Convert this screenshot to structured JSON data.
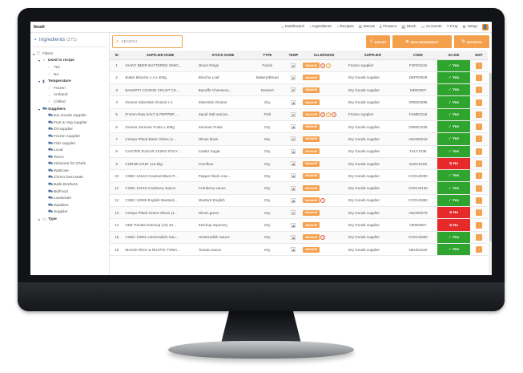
{
  "app": {
    "logo": "Itoodi"
  },
  "nav": [
    {
      "icon": "⌂",
      "label": "Dashboard"
    },
    {
      "icon": "◔",
      "label": "Ingredients"
    },
    {
      "icon": "◔",
      "label": "Recipes"
    },
    {
      "icon": "☰",
      "label": "Menus"
    },
    {
      "icon": "£",
      "label": "Finance"
    },
    {
      "icon": "▤",
      "label": "Stock"
    },
    {
      "icon": "▭",
      "label": "Accounts"
    },
    {
      "icon": "?",
      "label": "FAQ"
    },
    {
      "icon": "⚙",
      "label": "Setup"
    }
  ],
  "sidebar": {
    "title": "Ingredients",
    "count": "(271)",
    "filters_label": "Filters",
    "tree": [
      {
        "level": 0,
        "arrow": "▾",
        "icon": "▽",
        "label": "Filters",
        "bold": false
      },
      {
        "level": 1,
        "arrow": "▾",
        "icon": "◔",
        "label": "Used in recipe",
        "bold": true
      },
      {
        "level": 2,
        "arrow": "",
        "icon": "◌",
        "label": "Yes",
        "bold": false
      },
      {
        "level": 2,
        "arrow": "",
        "icon": "◌",
        "label": "No",
        "bold": false
      },
      {
        "level": 1,
        "arrow": "▾",
        "icon": "▮",
        "label": "Temperature",
        "bold": true
      },
      {
        "level": 2,
        "arrow": "",
        "icon": "◌",
        "label": "Frozen",
        "bold": false
      },
      {
        "level": 2,
        "arrow": "",
        "icon": "◌",
        "label": "Ambient",
        "bold": false
      },
      {
        "level": 2,
        "arrow": "",
        "icon": "◌",
        "label": "Chilled",
        "bold": false
      },
      {
        "level": 1,
        "arrow": "▾",
        "icon": "⛟",
        "label": "Suppliers",
        "bold": true
      },
      {
        "level": 2,
        "arrow": "",
        "icon": "⛟",
        "label": "Dry Goods supplier",
        "bold": false
      },
      {
        "level": 2,
        "arrow": "",
        "icon": "⛟",
        "label": "Fruit & Veg supplier",
        "bold": false
      },
      {
        "level": 2,
        "arrow": "",
        "icon": "⛟",
        "label": "Oil supplier",
        "bold": false
      },
      {
        "level": 2,
        "arrow": "",
        "icon": "⛟",
        "label": "Frozen supplier",
        "bold": false
      },
      {
        "level": 2,
        "arrow": "",
        "icon": "⛟",
        "label": "Fish supplier",
        "bold": false
      },
      {
        "level": 2,
        "arrow": "",
        "icon": "⛟",
        "label": "Local",
        "bold": false
      },
      {
        "level": 2,
        "arrow": "",
        "icon": "⛟",
        "label": "Tesco",
        "bold": false
      },
      {
        "level": 2,
        "arrow": "",
        "icon": "⛟",
        "label": "Infusions for Chefs",
        "bold": false
      },
      {
        "level": 2,
        "arrow": "",
        "icon": "⛟",
        "label": "Waitrose",
        "bold": false
      },
      {
        "level": 2,
        "arrow": "",
        "icon": "⛟",
        "label": "Chris's best Mate",
        "bold": false
      },
      {
        "level": 2,
        "arrow": "",
        "icon": "⛟",
        "label": "Balls Brothers",
        "bold": false
      },
      {
        "level": 2,
        "arrow": "",
        "icon": "⛟",
        "label": "BidFood",
        "bold": false
      },
      {
        "level": 2,
        "arrow": "",
        "icon": "⛟",
        "label": "Lowlander",
        "bold": false
      },
      {
        "level": 2,
        "arrow": "",
        "icon": "⛟",
        "label": "Waddies",
        "bold": false
      },
      {
        "level": 2,
        "arrow": "",
        "icon": "⛟",
        "label": "Supplier",
        "bold": false
      },
      {
        "level": 1,
        "arrow": "▸",
        "icon": "▭",
        "label": "Type",
        "bold": true
      }
    ]
  },
  "toolbar": {
    "search_placeholder": "SEARCH",
    "import_label": "IMPORT",
    "new_label": "NEW INGREDIENT",
    "refresh_label": "REFRESH"
  },
  "table": {
    "headers": [
      "ID",
      "SUPPLIER NAME",
      "STOCK NAME",
      "TYPE",
      "TEMP",
      "ALLERGENS",
      "SUPPLIER",
      "CODE",
      "IN USE",
      "EDIT"
    ],
    "manage_label": "MANAGE",
    "rows": [
      {
        "id": "1",
        "supplier_name": "GIANT BEER BATTERED ONIO...",
        "stock_name": "Onion Rings",
        "type": "Fandv",
        "temp": "F",
        "allergens": [
          "3",
          "1"
        ],
        "supplier": "Frozen supplier",
        "code": "FOFE0118",
        "in_use": "Yes"
      },
      {
        "id": "2",
        "supplier_name": "Butter Brioche x 4 x 400g",
        "stock_name": "Brioche Loaf",
        "type": "Bakery/Bread",
        "temp": "F",
        "allergens": [],
        "supplier": "Dry Goods supplier",
        "code": "DEFR0029",
        "in_use": "Yes"
      },
      {
        "id": "3",
        "supplier_name": "BANOFFI COOKIE CRUST CH...",
        "stock_name": "Banoffe Cheeseca...",
        "type": "Dessert",
        "temp": "F",
        "allergens": [],
        "supplier": "Dry Goods supplier",
        "code": "SIDE0007",
        "in_use": "Yes"
      },
      {
        "id": "4",
        "supplier_name": "Greens Silverskin Onions x 1",
        "stock_name": "Silverskin Onions",
        "type": "Dry",
        "temp": "A",
        "allergens": [],
        "supplier": "Dry Goods supplier",
        "code": "GREE0286",
        "in_use": "Yes"
      },
      {
        "id": "5",
        "supplier_name": "Frozen Raw SALT & PEPPER ...",
        "stock_name": "Squid Salt and pe...",
        "type": "Fish",
        "temp": "F",
        "allergens": [
          "3",
          "1",
          "1"
        ],
        "supplier": "Frozen supplier",
        "code": "FAME0118",
        "in_use": "Yes"
      },
      {
        "id": "6",
        "supplier_name": "Greens Summer Fruits x 400g",
        "stock_name": "Summer Fruits",
        "type": "Dry",
        "temp": "A",
        "allergens": [],
        "supplier": "Dry Goods supplier",
        "code": "GREE1035",
        "in_use": "Yes"
      },
      {
        "id": "7",
        "supplier_name": "Crespo Pitted Black Olives (1...",
        "stock_name": "Olives black",
        "type": "Dry",
        "temp": "C",
        "allergens": [],
        "supplier": "Dry Goods supplier",
        "code": "AMAR0015",
        "in_use": "Yes"
      },
      {
        "id": "8",
        "supplier_name": "CASTER SUGAR 1X2KG POLY ...",
        "stock_name": "Caster Sugar",
        "type": "Dry",
        "temp": "A",
        "allergens": [],
        "supplier": "Dry Goods supplier",
        "code": "TALY1035",
        "in_use": "Yes"
      },
      {
        "id": "9",
        "supplier_name": "CORNFLOUR 1x3.5kg",
        "stock_name": "Cornflour",
        "type": "Dry",
        "temp": "A",
        "allergens": [],
        "supplier": "Dry Goods supplier",
        "code": "SLEC0155",
        "in_use": "No"
      },
      {
        "id": "10",
        "supplier_name": "CSBC 10143 Cracked Black P...",
        "stock_name": "Pepper black crac...",
        "type": "Dry",
        "temp": "A",
        "allergens": [],
        "supplier": "Dry Goods supplier",
        "code": "COCU9330",
        "in_use": "Yes"
      },
      {
        "id": "11",
        "supplier_name": "CSBC 10143 Cranberry Sauce",
        "stock_name": "Cranberry sauce",
        "type": "Dry",
        "temp": "A",
        "allergens": [],
        "supplier": "Dry Goods supplier",
        "code": "COCU9130",
        "in_use": "Yes"
      },
      {
        "id": "12",
        "supplier_name": "CSBC 10085 English Mustard...",
        "stock_name": "Mustard English",
        "type": "Dry",
        "temp": "A",
        "allergens": [
          "1"
        ],
        "supplier": "Dry Goods supplier",
        "code": "COCU9350",
        "in_use": "Yes"
      },
      {
        "id": "13",
        "supplier_name": "Crespo Pitted Green Olives (1...",
        "stock_name": "Olives green",
        "type": "Dry",
        "temp": "C",
        "allergens": [],
        "supplier": "Dry Goods supplier",
        "code": "AMAR0075",
        "in_use": "No"
      },
      {
        "id": "14",
        "supplier_name": "HNZ Tomato Ketchup (10) 34...",
        "stock_name": "Ketchup Squeezy",
        "type": "Dry",
        "temp": "A",
        "allergens": [],
        "supplier": "Dry Goods supplier",
        "code": "HEIN3007",
        "in_use": "No"
      },
      {
        "id": "15",
        "supplier_name": "CSBC 10081 Horseradish Sau...",
        "stock_name": "Horseradish Sauce",
        "type": "Dry",
        "temp": "A",
        "allergens": [
          "1"
        ],
        "supplier": "Dry Goods supplier",
        "code": "COCU9300",
        "in_use": "Yes"
      },
      {
        "id": "16",
        "supplier_name": "MAGGI RICH & RUSTIC TOMA...",
        "stock_name": "Tomato sauce",
        "type": "Dry",
        "temp": "A",
        "allergens": [],
        "supplier": "Dry Goods supplier",
        "code": "NEUK6120",
        "in_use": "Yes"
      }
    ]
  },
  "colors": {
    "accent_orange": "#f5a04d",
    "in_use_yes": "#2fa52f",
    "in_use_no": "#e62a2a",
    "brand_blue": "#4a6d99"
  }
}
